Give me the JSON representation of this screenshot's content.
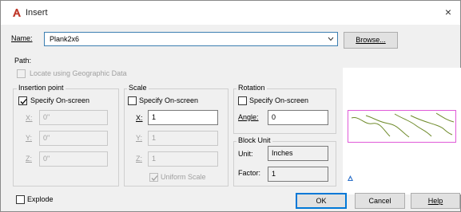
{
  "window": {
    "title": "Insert",
    "close_glyph": "×",
    "accent": "#c0392b"
  },
  "name": {
    "label": "Name:",
    "value": "Plank2x6",
    "browse_label": "Browse..."
  },
  "path": {
    "label": "Path:"
  },
  "geo": {
    "label": "Locate using Geographic Data",
    "checked": false
  },
  "insertion_point": {
    "title": "Insertion point",
    "specify_label": "Specify On-screen",
    "specify_checked": true,
    "x_label": "X:",
    "x_value": "0\"",
    "y_label": "Y:",
    "y_value": "0\"",
    "z_label": "Z:",
    "z_value": "0\""
  },
  "scale": {
    "title": "Scale",
    "specify_label": "Specify On-screen",
    "specify_checked": false,
    "x_label": "X:",
    "x_value": "1",
    "y_label": "Y:",
    "y_value": "1",
    "z_label": "Z:",
    "z_value": "1",
    "uniform_label": "Uniform Scale",
    "uniform_checked": true
  },
  "rotation": {
    "title": "Rotation",
    "specify_label": "Specify On-screen",
    "specify_checked": false,
    "angle_label": "Angle:",
    "angle_value": "0"
  },
  "block_unit": {
    "title": "Block Unit",
    "unit_label": "Unit:",
    "unit_value": "Inches",
    "factor_label": "Factor:",
    "factor_value": "1"
  },
  "explode": {
    "label": "Explode",
    "checked": false
  },
  "buttons": {
    "ok": "OK",
    "cancel": "Cancel",
    "help": "Help"
  },
  "icons": {
    "app": "autocad-a-icon",
    "dropdown": "chevron-down-icon",
    "close": "close-icon",
    "preview_pick": "triangle-icon"
  }
}
